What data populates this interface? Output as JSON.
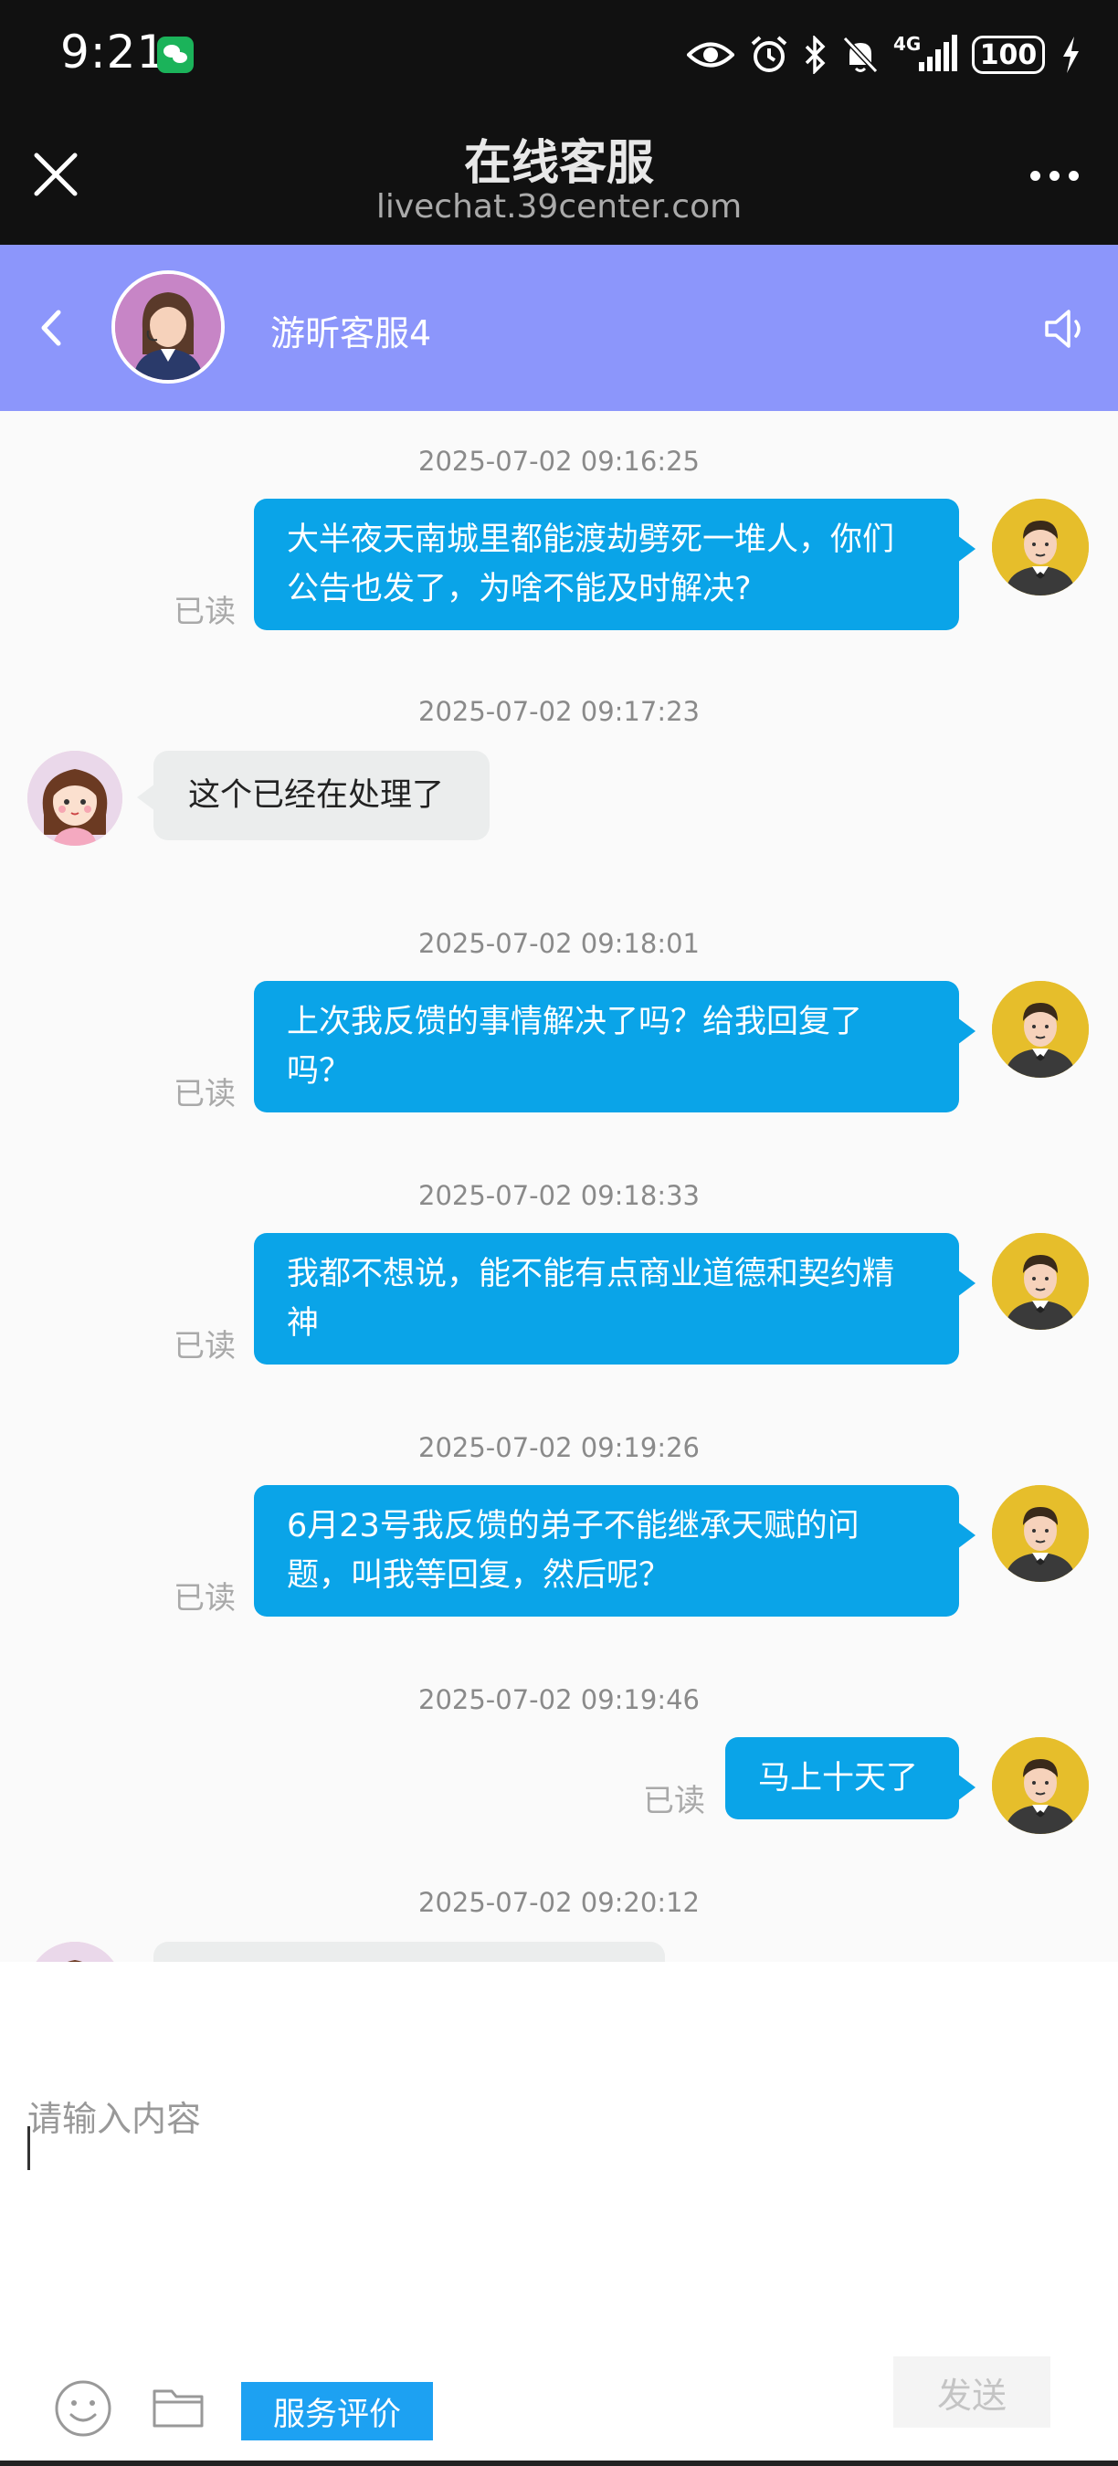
{
  "status_bar": {
    "time": "9:21",
    "network": "4G",
    "battery": "100"
  },
  "web_header": {
    "title": "在线客服",
    "url": "livechat.39center.com"
  },
  "chat_header": {
    "agent_name": "游昕客服4"
  },
  "messages": [
    {
      "timestamp": "2025-07-02 09:16:25",
      "direction": "out",
      "lines": [
        "大半夜天南城里都能渡劫劈死一堆人，你们",
        "公告也发了，为啥不能及时解决?"
      ],
      "status": "已读"
    },
    {
      "timestamp": "2025-07-02 09:17:23",
      "direction": "in",
      "lines": [
        "这个已经在处理了"
      ]
    },
    {
      "timestamp": "2025-07-02 09:18:01",
      "direction": "out",
      "lines": [
        "上次我反馈的事情解决了吗？给我回复了",
        "吗？"
      ],
      "status": "已读"
    },
    {
      "timestamp": "2025-07-02 09:18:33",
      "direction": "out",
      "lines": [
        "我都不想说，能不能有点商业道德和契约精",
        "神"
      ],
      "status": "已读"
    },
    {
      "timestamp": "2025-07-02 09:19:26",
      "direction": "out",
      "lines": [
        "6月23号我反馈的弟子不能继承天赋的问",
        "题，叫我等回复，然后呢？"
      ],
      "status": "已读"
    },
    {
      "timestamp": "2025-07-02 09:19:46",
      "direction": "out",
      "lines": [
        "马上十天了"
      ],
      "status": "已读"
    },
    {
      "timestamp": "2025-07-02 09:20:12",
      "direction": "in",
      "lines": [
        ""
      ]
    }
  ],
  "input": {
    "placeholder": "请输入内容",
    "value": ""
  },
  "toolbar": {
    "send_label": "发送",
    "rating_label": "服务评价",
    "emoji_icon": "emoji-icon",
    "folder_icon": "folder-icon"
  },
  "colors": {
    "header_purple": "#8c96fb",
    "bubble_blue": "#0aa4e8",
    "rating_blue": "#1da1f2"
  }
}
